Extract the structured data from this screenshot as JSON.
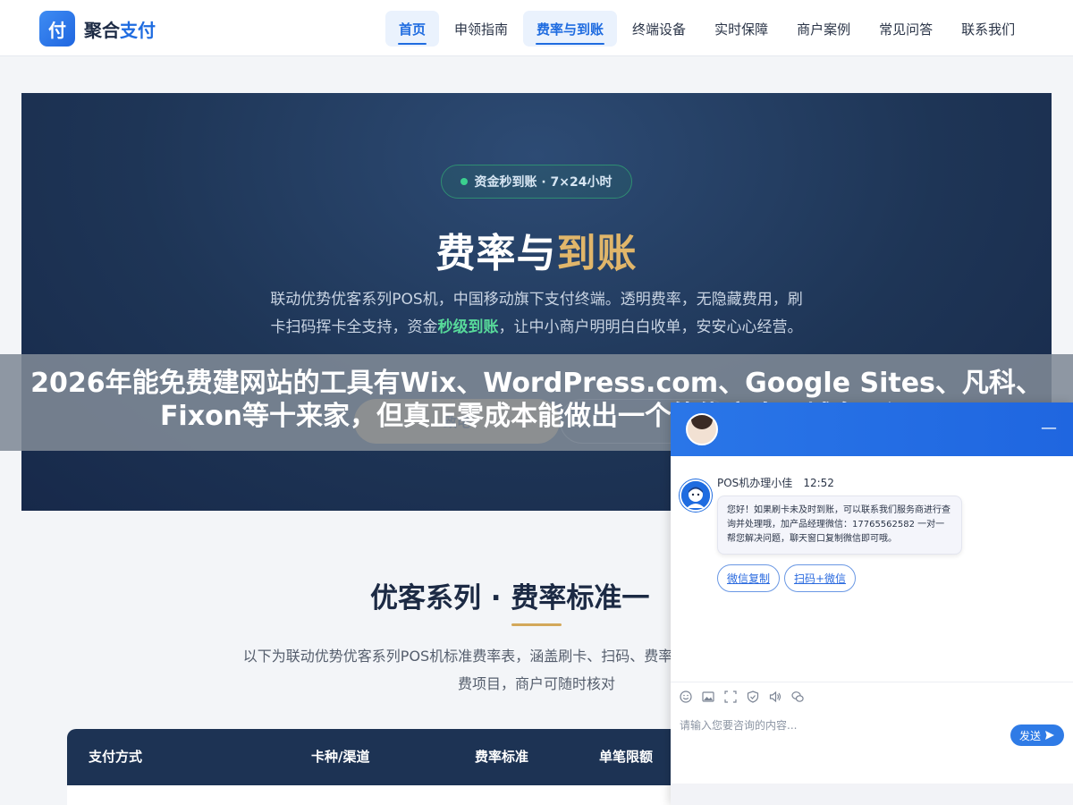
{
  "header": {
    "logo_mark": "付",
    "logo_text_part1": "聚合",
    "logo_text_part2": "支付",
    "nav": [
      {
        "label": "首页",
        "active": true
      },
      {
        "label": "申领指南",
        "active": false
      },
      {
        "label": "费率与到账",
        "active": true
      },
      {
        "label": "终端设备",
        "active": false
      },
      {
        "label": "实时保障",
        "active": false
      },
      {
        "label": "商户案例",
        "active": false
      },
      {
        "label": "常见问答",
        "active": false
      },
      {
        "label": "联系我们",
        "active": false
      }
    ]
  },
  "hero": {
    "badge": "资金秒到账 · 7×24小时",
    "title_white": "费率与",
    "title_gold": "到账",
    "desc_part1": "联动优势优客系列POS机，中国移动旗下支付终端。透明费率，无隐藏费用，刷卡扫码挥卡全支持，资金",
    "desc_highlight": "秒级到账",
    "desc_part2": "，让中小商户明明白白收单，安安心心经营。",
    "button_primary": "致电",
    "button_secondary": ""
  },
  "overlay": {
    "text": "2026年能免费建网站的工具有Wix、WordPress.com、Google Sites、凡科、Fixon等十来家，但真正零成本能做出一个能绑定自己域名、没"
  },
  "section": {
    "title": "优客系列 · 费率标准一",
    "desc": "以下为联动优势优客系列POS机标准费率表，涵盖刷卡、扫码、费率公开透明，无任何隐藏扣费项目，商户可随时核对"
  },
  "table": {
    "headers": [
      "支付方式",
      "卡种/渠道",
      "费率标准",
      "单笔限额"
    ]
  },
  "chat": {
    "agent_name": "POS机办理小佳",
    "time": "12:52",
    "message": "您好！如果刷卡未及时到账，可以联系我们服务商进行查询并处理哦，加产品经理微信：17765562582 一对一帮您解决问题，聊天窗口复制微信即可哦。",
    "chips": [
      "微信复制",
      "扫码+微信"
    ],
    "input_placeholder": "请输入您要咨询的内容...",
    "send_label": "发送",
    "minimize_label": "—"
  },
  "colors": {
    "brand_blue": "#1f6ce0",
    "hero_navy": "#1e3556",
    "gold": "#e1b66a",
    "green": "#57d99a"
  }
}
